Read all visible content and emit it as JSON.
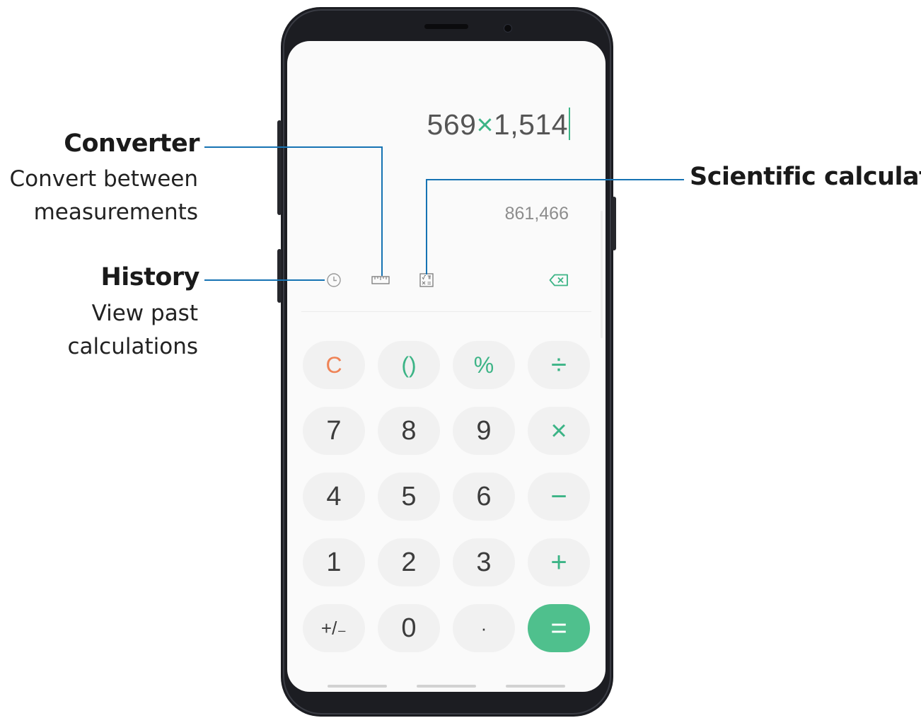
{
  "calculator": {
    "expression": {
      "operand_1": "569",
      "operator": "×",
      "operand_2": "1,514"
    },
    "result": "861,466",
    "toolbar": {
      "history_icon": "clock-icon",
      "converter_icon": "ruler-icon",
      "scientific_icon": "scientific-calculator-icon",
      "backspace_icon": "backspace-icon"
    },
    "keys": {
      "clear": "C",
      "parentheses": "()",
      "percent": "%",
      "divide": "÷",
      "seven": "7",
      "eight": "8",
      "nine": "9",
      "multiply": "×",
      "four": "4",
      "five": "5",
      "six": "6",
      "subtract": "−",
      "one": "1",
      "two": "2",
      "three": "3",
      "add": "+",
      "plus_minus": "+/₋",
      "zero": "0",
      "decimal": "·",
      "equals": "="
    }
  },
  "callouts": {
    "converter": {
      "title": "Converter",
      "line_1": "Convert between",
      "line_2": "measurements"
    },
    "history": {
      "title": "History",
      "line_1": "View past",
      "line_2": "calculations"
    },
    "scientific": {
      "title": "Scientific calculator"
    }
  },
  "colors": {
    "accent_green": "#3cb486",
    "equals_button": "#4fc08d",
    "clear_orange": "#ef8356",
    "callout_line": "#1673b3",
    "key_background": "#f1f1f1"
  }
}
